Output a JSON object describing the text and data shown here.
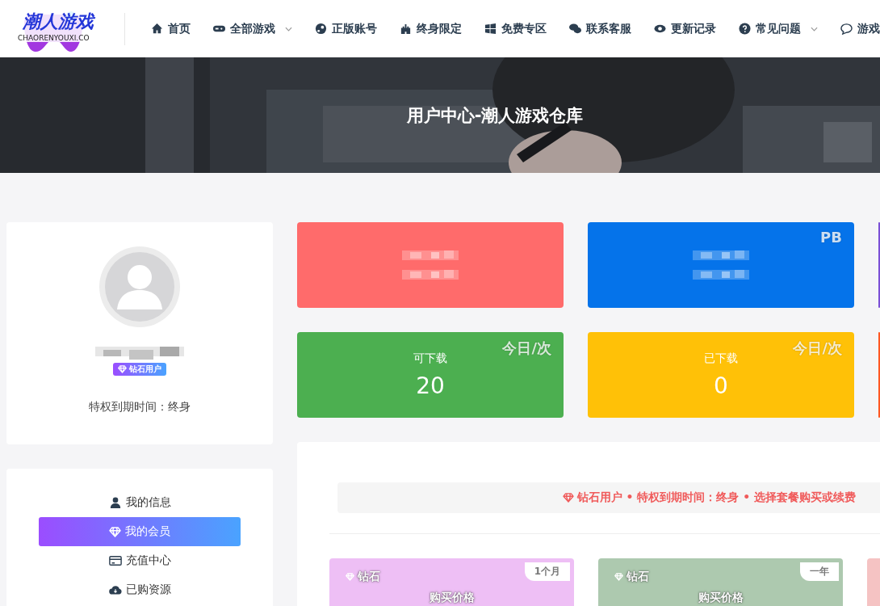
{
  "logo": {
    "title": "潮人游戏",
    "subtitle": "CHAORENYOUXI.CO"
  },
  "nav": [
    {
      "label": "首页",
      "dropdown": false
    },
    {
      "label": "全部游戏",
      "dropdown": true
    },
    {
      "label": "正版账号",
      "dropdown": false
    },
    {
      "label": "终身限定",
      "dropdown": false
    },
    {
      "label": "免费专区",
      "dropdown": false
    },
    {
      "label": "联系客服",
      "dropdown": false
    },
    {
      "label": "更新记录",
      "dropdown": false
    },
    {
      "label": "常见问题",
      "dropdown": true
    },
    {
      "label": "游戏",
      "dropdown": false
    }
  ],
  "banner": {
    "title": "用户中心-潮人游戏仓库"
  },
  "profile": {
    "badge": "钻石用户",
    "expiry": "特权到期时间：终身"
  },
  "menu": [
    {
      "label": "我的信息",
      "selected": false
    },
    {
      "label": "我的会员",
      "selected": true
    },
    {
      "label": "充值中心",
      "selected": false
    },
    {
      "label": "已购资源",
      "selected": false
    }
  ],
  "stats": [
    {
      "kind": "blurred",
      "color": "#ff6b6b"
    },
    {
      "kind": "blurred",
      "color": "#0573ea",
      "corner": "PB"
    },
    {
      "kind": "edge",
      "color": "#7a4fd6"
    },
    {
      "kind": "stat",
      "color": "#4caf50",
      "label": "可下载",
      "value": "20",
      "corner": "今日/次"
    },
    {
      "kind": "stat",
      "color": "#ffc107",
      "label": "已下载",
      "value": "0",
      "corner": "今日/次"
    },
    {
      "kind": "edge",
      "color": "#ff5722"
    }
  ],
  "notice": "钻石用户 • 特权到期时间：终身 • 选择套餐购买或续费",
  "plans": [
    {
      "color": "#eebff5",
      "name": "钻石",
      "period": "1个月",
      "price_label": "购买价格"
    },
    {
      "color": "#adc9af",
      "name": "钻石",
      "period": "一年",
      "price_label": "购买价格"
    },
    {
      "color": "#f5c3c3"
    }
  ]
}
